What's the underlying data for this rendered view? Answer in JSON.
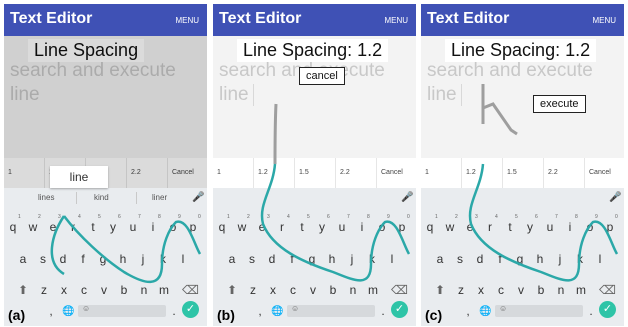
{
  "app": {
    "title": "Text Editor",
    "menu": "MENU"
  },
  "ghost": {
    "line1": "search and execute",
    "line2": "line"
  },
  "spacing_options": [
    "1",
    "1.2",
    "1.5",
    "2.2",
    "Cancel"
  ],
  "suggestions": [
    "lines",
    "kind",
    "liner"
  ],
  "keyboard": {
    "row1": [
      "q",
      "w",
      "e",
      "r",
      "t",
      "y",
      "u",
      "i",
      "o",
      "p"
    ],
    "row1_nums": [
      "1",
      "2",
      "3",
      "4",
      "5",
      "6",
      "7",
      "8",
      "9",
      "0"
    ],
    "row2": [
      "a",
      "s",
      "d",
      "f",
      "g",
      "h",
      "j",
      "k",
      "l"
    ],
    "row3": [
      "z",
      "x",
      "c",
      "v",
      "b",
      "n",
      "m"
    ],
    "comma": ",",
    "period": "."
  },
  "panels": [
    {
      "tag": "(a)",
      "label": "Line Spacing",
      "popup": "line"
    },
    {
      "tag": "(b)",
      "label": "Line Spacing: 1.2",
      "command": "cancel"
    },
    {
      "tag": "(c)",
      "label": "Line Spacing: 1.2",
      "command": "execute"
    }
  ],
  "colors": {
    "appbar": "#3f51b5",
    "gesture": "#2ba8a8",
    "stroke": "#999999",
    "enter": "#2ec4a7"
  },
  "icons": [
    "mic-icon",
    "shift-icon",
    "backspace-icon",
    "globe-icon",
    "emoji-icon",
    "enter-icon"
  ]
}
